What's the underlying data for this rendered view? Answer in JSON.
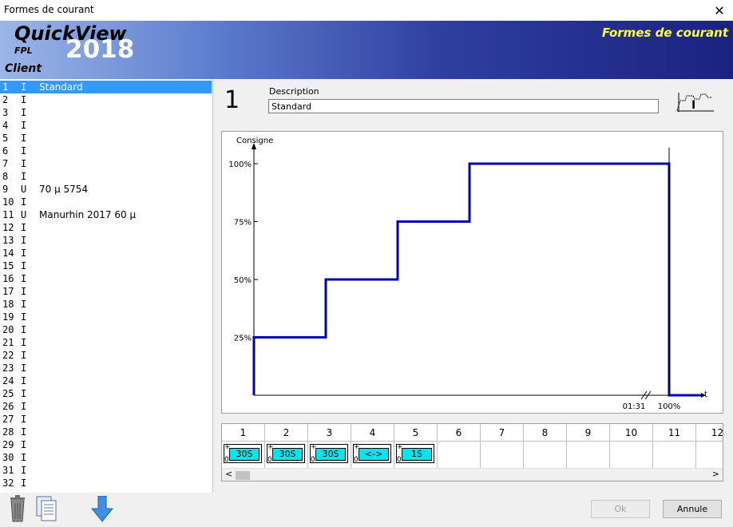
{
  "window": {
    "title": "Formes de courant",
    "close_glyph": "✕"
  },
  "banner": {
    "app_name": "QuickView",
    "year": "2018",
    "edition": "FPL",
    "client_label": "Client",
    "section_title": "Formes de courant"
  },
  "list": {
    "rows": [
      {
        "num": "1",
        "type": "I",
        "desc": "Standard",
        "selected": true
      },
      {
        "num": "2",
        "type": "I",
        "desc": ""
      },
      {
        "num": "3",
        "type": "I",
        "desc": ""
      },
      {
        "num": "4",
        "type": "I",
        "desc": ""
      },
      {
        "num": "5",
        "type": "I",
        "desc": ""
      },
      {
        "num": "6",
        "type": "I",
        "desc": ""
      },
      {
        "num": "7",
        "type": "I",
        "desc": ""
      },
      {
        "num": "8",
        "type": "I",
        "desc": ""
      },
      {
        "num": "9",
        "type": "U",
        "desc": "70 µ 5754"
      },
      {
        "num": "10",
        "type": "I",
        "desc": ""
      },
      {
        "num": "11",
        "type": "U",
        "desc": "Manurhin 2017 60 µ"
      },
      {
        "num": "12",
        "type": "I",
        "desc": ""
      },
      {
        "num": "13",
        "type": "I",
        "desc": ""
      },
      {
        "num": "14",
        "type": "I",
        "desc": ""
      },
      {
        "num": "15",
        "type": "I",
        "desc": ""
      },
      {
        "num": "16",
        "type": "I",
        "desc": ""
      },
      {
        "num": "17",
        "type": "I",
        "desc": ""
      },
      {
        "num": "18",
        "type": "I",
        "desc": ""
      },
      {
        "num": "19",
        "type": "I",
        "desc": ""
      },
      {
        "num": "20",
        "type": "I",
        "desc": ""
      },
      {
        "num": "21",
        "type": "I",
        "desc": ""
      },
      {
        "num": "22",
        "type": "I",
        "desc": ""
      },
      {
        "num": "23",
        "type": "I",
        "desc": ""
      },
      {
        "num": "24",
        "type": "I",
        "desc": ""
      },
      {
        "num": "25",
        "type": "I",
        "desc": ""
      },
      {
        "num": "26",
        "type": "I",
        "desc": ""
      },
      {
        "num": "27",
        "type": "I",
        "desc": ""
      },
      {
        "num": "28",
        "type": "I",
        "desc": ""
      },
      {
        "num": "29",
        "type": "I",
        "desc": ""
      },
      {
        "num": "30",
        "type": "I",
        "desc": ""
      },
      {
        "num": "31",
        "type": "I",
        "desc": ""
      },
      {
        "num": "32",
        "type": "I",
        "desc": ""
      }
    ]
  },
  "detail": {
    "number": "1",
    "description_label": "Description",
    "description_value": "Standard",
    "waveform_icon": "current-waveform-icon"
  },
  "chart_data": {
    "type": "line",
    "ylabel": "Consigne",
    "xlabel": "t",
    "y_ticks": [
      "25%",
      "50%",
      "75%",
      "100%"
    ],
    "x_tick_labels": [
      "01:31",
      "100%"
    ],
    "color": "#0000b4",
    "segments": [
      {
        "step": 1,
        "level": 25
      },
      {
        "step": 2,
        "level": 50
      },
      {
        "step": 3,
        "level": 75
      },
      {
        "step": 4,
        "level": 100
      }
    ],
    "final_level": 0
  },
  "steps": {
    "columns": [
      "1",
      "2",
      "3",
      "4",
      "5",
      "6",
      "7",
      "8",
      "9",
      "10",
      "11",
      "12"
    ],
    "cells": [
      {
        "label": "30S",
        "plus": "+",
        "zero": "0"
      },
      {
        "label": "30S",
        "plus": "+",
        "zero": "0"
      },
      {
        "label": "30S",
        "plus": "+",
        "zero": "0"
      },
      {
        "label": "<->",
        "plus": "+",
        "zero": "0"
      },
      {
        "label": "1S",
        "plus": "+",
        "zero": "0"
      }
    ],
    "scroll_left": "<",
    "scroll_right": ">"
  },
  "toolbar": {
    "delete_icon": "trash-icon",
    "copy_icon": "copy-icon",
    "import_icon": "arrow-down-icon"
  },
  "buttons": {
    "ok_label": "Ok",
    "cancel_label": "Annule"
  }
}
